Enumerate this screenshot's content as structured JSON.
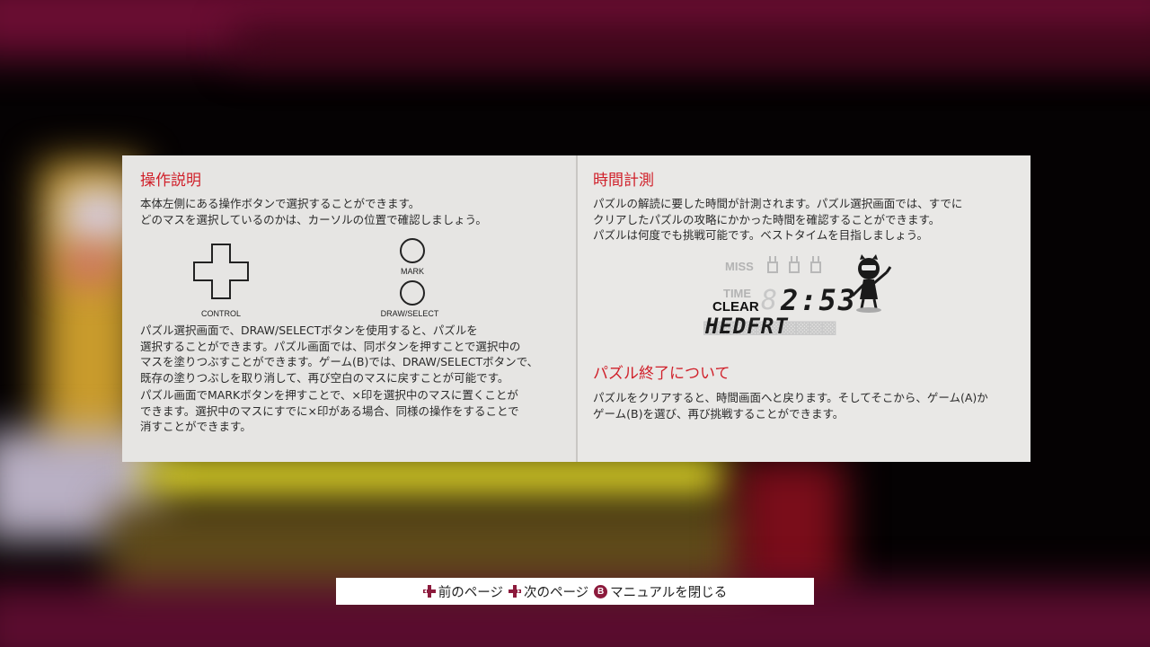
{
  "left_page": {
    "title": "操作説明",
    "intro": "本体左側にある操作ボタンで選択することができます。\nどのマスを選択しているのかは、カーソルの位置で確認しましょう。",
    "control_label": "CONTROL",
    "mark_label": "MARK",
    "draw_select_label": "DRAW/SELECT",
    "para1": "パズル選択画面で、DRAW/SELECTボタンを使用すると、パズルを\n選択することができます。パズル画面では、同ボタンを押すことで選択中の\nマスを塗りつぶすことができます。ゲーム(B)では、DRAW/SELECTボタンで、\n既存の塗りつぶしを取り消して、再び空白のマスに戻すことが可能です。",
    "para2": "パズル画面でMARKボタンを押すことで、×印を選択中のマスに置くことが\nできます。選択中のマスにすでに×印がある場合、同様の操作をすることで\n消すことができます。"
  },
  "right_page": {
    "title": "時間計測",
    "intro": "パズルの解読に要した時間が計測されます。パズル選択画面では、すでに\nクリアしたパズルの攻略にかかった時間を確認することができます。\nパズルは何度でも挑戦可能です。ベストタイムを目指しましょう。",
    "lcd": {
      "miss_label": "MISS",
      "time_label": "TIME",
      "clear_label": "CLEAR",
      "time_value": "2:53",
      "name_value": "HEDFRT"
    },
    "end_title": "パズル終了について",
    "end_text": "パズルをクリアすると、時間画面へと戻ります。そしてそこから、ゲーム(A)か\nゲーム(B)を選び、再び挑戦することができます。"
  },
  "footer": {
    "prev_label": "前のページ",
    "next_label": "次のページ",
    "close_label": "マニュアルを閉じる",
    "b_button": "B",
    "prev_icon": "dpad-icon",
    "next_icon": "dpad-icon"
  },
  "colors": {
    "title_red": "#d0202a",
    "button_maroon": "#8c1a3c",
    "paper": "#e7e6e4"
  }
}
